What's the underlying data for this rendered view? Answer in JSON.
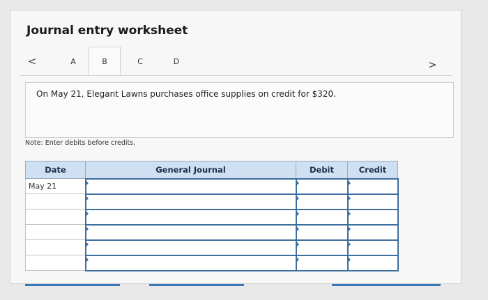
{
  "header": {
    "title": "Journal entry worksheet"
  },
  "tabs": {
    "prev_icon": "<",
    "next_icon": ">",
    "items": [
      {
        "label": "A"
      },
      {
        "label": "B"
      },
      {
        "label": "C"
      },
      {
        "label": "D"
      }
    ],
    "selected": "B"
  },
  "question": {
    "text": "On May 21, Elegant Lawns purchases office supplies on credit for $320."
  },
  "note": {
    "text": "Note: Enter debits before credits."
  },
  "journal": {
    "columns": [
      "Date",
      "General Journal",
      "Debit",
      "Credit"
    ],
    "rows": [
      {
        "date": "May 21",
        "account": "",
        "debit": "",
        "credit": ""
      },
      {
        "date": "",
        "account": "",
        "debit": "",
        "credit": ""
      },
      {
        "date": "",
        "account": "",
        "debit": "",
        "credit": ""
      },
      {
        "date": "",
        "account": "",
        "debit": "",
        "credit": ""
      },
      {
        "date": "",
        "account": "",
        "debit": "",
        "credit": ""
      },
      {
        "date": "",
        "account": "",
        "debit": "",
        "credit": ""
      }
    ]
  },
  "colors": {
    "header_bg": "#cfe0f3",
    "input_border": "#3d6e9e",
    "accent": "#3d77b8"
  }
}
